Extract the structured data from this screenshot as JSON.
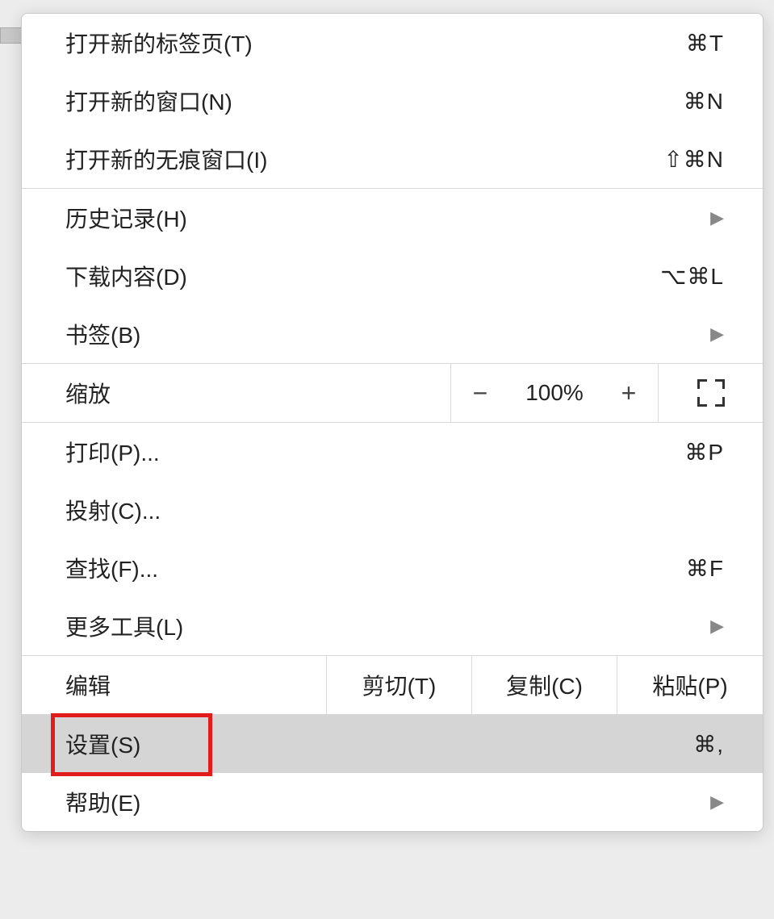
{
  "menu": {
    "items": [
      {
        "label": "打开新的标签页(T)",
        "shortcut": "⌘T",
        "hasSubmenu": false
      },
      {
        "label": "打开新的窗口(N)",
        "shortcut": "⌘N",
        "hasSubmenu": false
      },
      {
        "label": "打开新的无痕窗口(I)",
        "shortcut": "⇧⌘N",
        "hasSubmenu": false
      }
    ],
    "history": {
      "label": "历史记录(H)",
      "hasSubmenu": true
    },
    "downloads": {
      "label": "下载内容(D)",
      "shortcut": "⌥⌘L",
      "hasSubmenu": false
    },
    "bookmarks": {
      "label": "书签(B)",
      "hasSubmenu": true
    },
    "zoom": {
      "label": "缩放",
      "value": "100%",
      "minus": "−",
      "plus": "+"
    },
    "print": {
      "label": "打印(P)...",
      "shortcut": "⌘P"
    },
    "cast": {
      "label": "投射(C)..."
    },
    "find": {
      "label": "查找(F)...",
      "shortcut": "⌘F"
    },
    "moreTools": {
      "label": "更多工具(L)",
      "hasSubmenu": true
    },
    "edit": {
      "label": "编辑",
      "cut": "剪切(T)",
      "copy": "复制(C)",
      "paste": "粘贴(P)"
    },
    "settings": {
      "label": "设置(S)",
      "shortcut": "⌘,"
    },
    "help": {
      "label": "帮助(E)",
      "hasSubmenu": true
    }
  }
}
